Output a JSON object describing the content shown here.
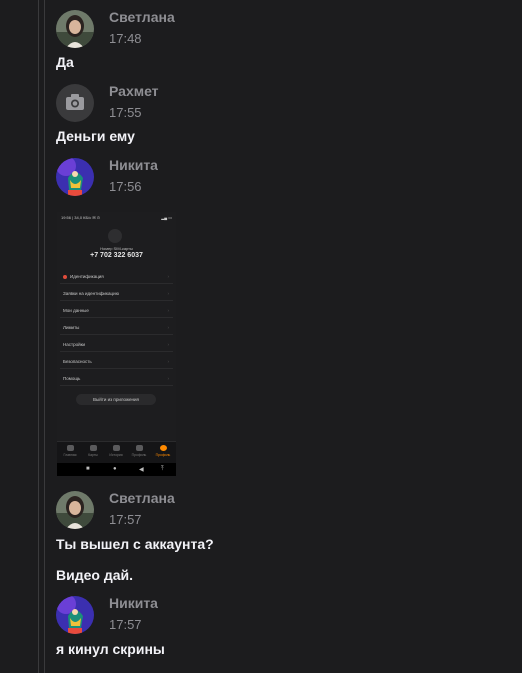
{
  "messages": [
    {
      "author": "Светлана",
      "time": "17:48",
      "text": "Да"
    },
    {
      "author": "Рахмет",
      "time": "17:55",
      "text": "Деньги ему"
    },
    {
      "author": "Никита",
      "time": "17:56"
    },
    {
      "author": "Светлана",
      "time": "17:57",
      "text": "Ты вышел с аккаунта?",
      "text2": "Видео дай."
    },
    {
      "author": "Никита",
      "time": "17:57",
      "text": "я кинул скрины"
    }
  ],
  "screenshot": {
    "status_left": "19:56 | 34,0 КБ/с ✉ ⊙",
    "status_right": "▂▄ ▭",
    "caption": "Номер SIM-карты",
    "phone": "+7 702 322 6037",
    "rows": [
      "Идентификация",
      "Заявки на идентификацию",
      "Мои данные",
      "Лимиты",
      "Настройки",
      "Безопасность",
      "Помощь"
    ],
    "logout": "Выйти из приложения",
    "tabs": [
      "Главная",
      "Карты",
      "История",
      "Профиль",
      "Профиль"
    ],
    "navbar": [
      "■",
      "●",
      "◀",
      "⤒"
    ]
  },
  "colors": {
    "bg": "#1c1c1e",
    "accent": "#ff8a00",
    "name": "#8e8e93",
    "text": "#f2f2f7"
  },
  "icons": {
    "camera_placeholder": "camera-icon"
  }
}
